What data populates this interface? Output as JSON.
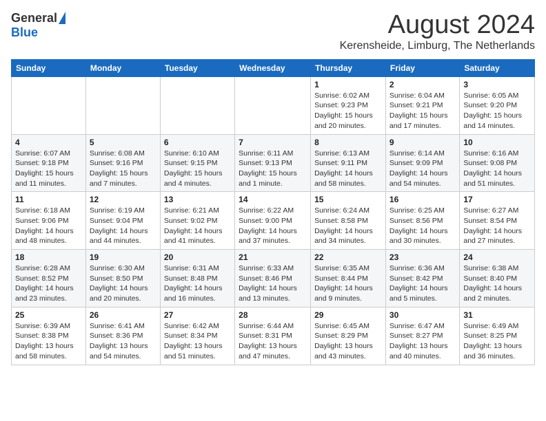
{
  "header": {
    "logo": {
      "general": "General",
      "blue": "Blue"
    },
    "title": "August 2024",
    "location": "Kerensheide, Limburg, The Netherlands"
  },
  "weekdays": [
    "Sunday",
    "Monday",
    "Tuesday",
    "Wednesday",
    "Thursday",
    "Friday",
    "Saturday"
  ],
  "weeks": [
    [
      {
        "day": "",
        "sunrise": "",
        "sunset": "",
        "daylight": ""
      },
      {
        "day": "",
        "sunrise": "",
        "sunset": "",
        "daylight": ""
      },
      {
        "day": "",
        "sunrise": "",
        "sunset": "",
        "daylight": ""
      },
      {
        "day": "",
        "sunrise": "",
        "sunset": "",
        "daylight": ""
      },
      {
        "day": "1",
        "sunrise": "Sunrise: 6:02 AM",
        "sunset": "Sunset: 9:23 PM",
        "daylight": "Daylight: 15 hours and 20 minutes."
      },
      {
        "day": "2",
        "sunrise": "Sunrise: 6:04 AM",
        "sunset": "Sunset: 9:21 PM",
        "daylight": "Daylight: 15 hours and 17 minutes."
      },
      {
        "day": "3",
        "sunrise": "Sunrise: 6:05 AM",
        "sunset": "Sunset: 9:20 PM",
        "daylight": "Daylight: 15 hours and 14 minutes."
      }
    ],
    [
      {
        "day": "4",
        "sunrise": "Sunrise: 6:07 AM",
        "sunset": "Sunset: 9:18 PM",
        "daylight": "Daylight: 15 hours and 11 minutes."
      },
      {
        "day": "5",
        "sunrise": "Sunrise: 6:08 AM",
        "sunset": "Sunset: 9:16 PM",
        "daylight": "Daylight: 15 hours and 7 minutes."
      },
      {
        "day": "6",
        "sunrise": "Sunrise: 6:10 AM",
        "sunset": "Sunset: 9:15 PM",
        "daylight": "Daylight: 15 hours and 4 minutes."
      },
      {
        "day": "7",
        "sunrise": "Sunrise: 6:11 AM",
        "sunset": "Sunset: 9:13 PM",
        "daylight": "Daylight: 15 hours and 1 minute."
      },
      {
        "day": "8",
        "sunrise": "Sunrise: 6:13 AM",
        "sunset": "Sunset: 9:11 PM",
        "daylight": "Daylight: 14 hours and 58 minutes."
      },
      {
        "day": "9",
        "sunrise": "Sunrise: 6:14 AM",
        "sunset": "Sunset: 9:09 PM",
        "daylight": "Daylight: 14 hours and 54 minutes."
      },
      {
        "day": "10",
        "sunrise": "Sunrise: 6:16 AM",
        "sunset": "Sunset: 9:08 PM",
        "daylight": "Daylight: 14 hours and 51 minutes."
      }
    ],
    [
      {
        "day": "11",
        "sunrise": "Sunrise: 6:18 AM",
        "sunset": "Sunset: 9:06 PM",
        "daylight": "Daylight: 14 hours and 48 minutes."
      },
      {
        "day": "12",
        "sunrise": "Sunrise: 6:19 AM",
        "sunset": "Sunset: 9:04 PM",
        "daylight": "Daylight: 14 hours and 44 minutes."
      },
      {
        "day": "13",
        "sunrise": "Sunrise: 6:21 AM",
        "sunset": "Sunset: 9:02 PM",
        "daylight": "Daylight: 14 hours and 41 minutes."
      },
      {
        "day": "14",
        "sunrise": "Sunrise: 6:22 AM",
        "sunset": "Sunset: 9:00 PM",
        "daylight": "Daylight: 14 hours and 37 minutes."
      },
      {
        "day": "15",
        "sunrise": "Sunrise: 6:24 AM",
        "sunset": "Sunset: 8:58 PM",
        "daylight": "Daylight: 14 hours and 34 minutes."
      },
      {
        "day": "16",
        "sunrise": "Sunrise: 6:25 AM",
        "sunset": "Sunset: 8:56 PM",
        "daylight": "Daylight: 14 hours and 30 minutes."
      },
      {
        "day": "17",
        "sunrise": "Sunrise: 6:27 AM",
        "sunset": "Sunset: 8:54 PM",
        "daylight": "Daylight: 14 hours and 27 minutes."
      }
    ],
    [
      {
        "day": "18",
        "sunrise": "Sunrise: 6:28 AM",
        "sunset": "Sunset: 8:52 PM",
        "daylight": "Daylight: 14 hours and 23 minutes."
      },
      {
        "day": "19",
        "sunrise": "Sunrise: 6:30 AM",
        "sunset": "Sunset: 8:50 PM",
        "daylight": "Daylight: 14 hours and 20 minutes."
      },
      {
        "day": "20",
        "sunrise": "Sunrise: 6:31 AM",
        "sunset": "Sunset: 8:48 PM",
        "daylight": "Daylight: 14 hours and 16 minutes."
      },
      {
        "day": "21",
        "sunrise": "Sunrise: 6:33 AM",
        "sunset": "Sunset: 8:46 PM",
        "daylight": "Daylight: 14 hours and 13 minutes."
      },
      {
        "day": "22",
        "sunrise": "Sunrise: 6:35 AM",
        "sunset": "Sunset: 8:44 PM",
        "daylight": "Daylight: 14 hours and 9 minutes."
      },
      {
        "day": "23",
        "sunrise": "Sunrise: 6:36 AM",
        "sunset": "Sunset: 8:42 PM",
        "daylight": "Daylight: 14 hours and 5 minutes."
      },
      {
        "day": "24",
        "sunrise": "Sunrise: 6:38 AM",
        "sunset": "Sunset: 8:40 PM",
        "daylight": "Daylight: 14 hours and 2 minutes."
      }
    ],
    [
      {
        "day": "25",
        "sunrise": "Sunrise: 6:39 AM",
        "sunset": "Sunset: 8:38 PM",
        "daylight": "Daylight: 13 hours and 58 minutes."
      },
      {
        "day": "26",
        "sunrise": "Sunrise: 6:41 AM",
        "sunset": "Sunset: 8:36 PM",
        "daylight": "Daylight: 13 hours and 54 minutes."
      },
      {
        "day": "27",
        "sunrise": "Sunrise: 6:42 AM",
        "sunset": "Sunset: 8:34 PM",
        "daylight": "Daylight: 13 hours and 51 minutes."
      },
      {
        "day": "28",
        "sunrise": "Sunrise: 6:44 AM",
        "sunset": "Sunset: 8:31 PM",
        "daylight": "Daylight: 13 hours and 47 minutes."
      },
      {
        "day": "29",
        "sunrise": "Sunrise: 6:45 AM",
        "sunset": "Sunset: 8:29 PM",
        "daylight": "Daylight: 13 hours and 43 minutes."
      },
      {
        "day": "30",
        "sunrise": "Sunrise: 6:47 AM",
        "sunset": "Sunset: 8:27 PM",
        "daylight": "Daylight: 13 hours and 40 minutes."
      },
      {
        "day": "31",
        "sunrise": "Sunrise: 6:49 AM",
        "sunset": "Sunset: 8:25 PM",
        "daylight": "Daylight: 13 hours and 36 minutes."
      }
    ]
  ]
}
